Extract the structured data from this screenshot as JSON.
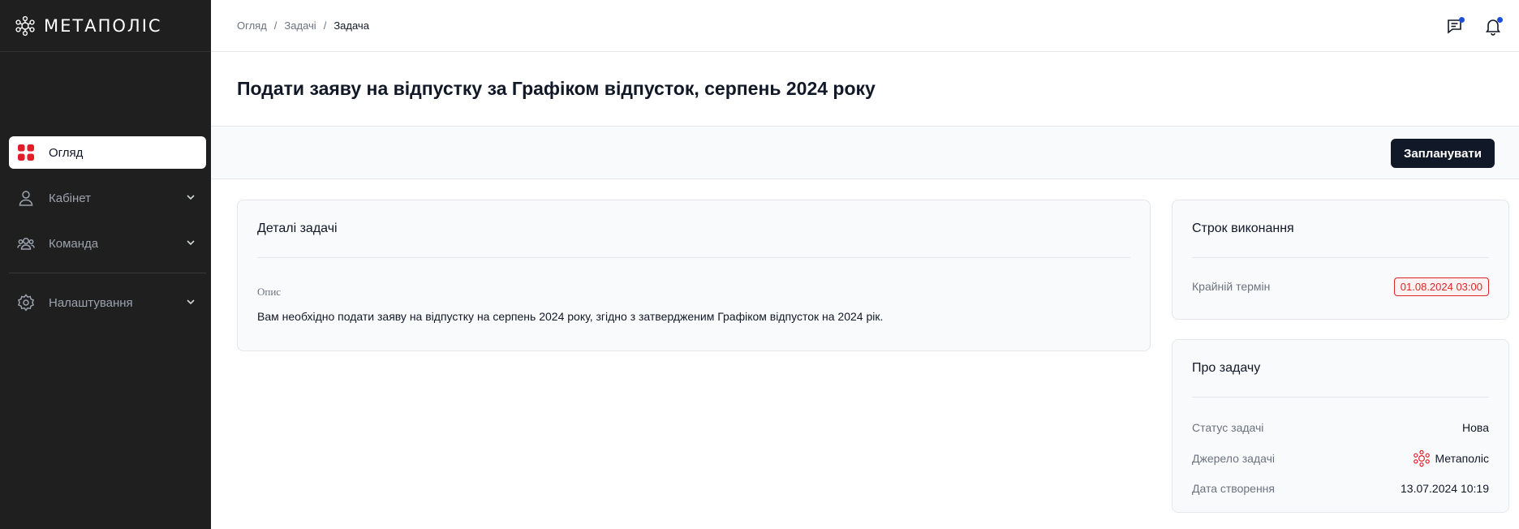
{
  "brand": {
    "name": "МЕТАПОЛІС"
  },
  "sidebar": {
    "items": [
      {
        "label": "Огляд",
        "icon": "grid-icon",
        "active": true
      },
      {
        "label": "Кабінет",
        "icon": "user-icon"
      },
      {
        "label": "Команда",
        "icon": "team-icon"
      },
      {
        "label": "Налаштування",
        "icon": "gear-icon"
      }
    ]
  },
  "breadcrumb": {
    "items": [
      "Огляд",
      "Задачі",
      "Задача"
    ],
    "separator": "/"
  },
  "page": {
    "title": "Подати заяву на відпустку за Графіком відпусток, серпень 2024 року"
  },
  "actions": {
    "plan_label": "Запланувати"
  },
  "details": {
    "title": "Деталі задачі",
    "desc_label": "Опис",
    "desc_text": "Вам необхідно подати заяву на відпустку на серпень 2024 року, згідно з затвердженим Графіком відпусток на 2024 рік."
  },
  "deadline": {
    "title": "Строк виконання",
    "label": "Крайній термін",
    "value": "01.08.2024 03:00"
  },
  "about": {
    "title": "Про задачу",
    "status_label": "Статус задачі",
    "status_value": "Нова",
    "source_label": "Джерело задачі",
    "source_value": "Метаполіс",
    "created_label": "Дата створення",
    "created_value": "13.07.2024 10:19"
  },
  "colors": {
    "accent": "#e11d2a",
    "sidebar_bg": "#1f1f1f",
    "button_bg": "#111827",
    "notification_dot": "#1d4ed8"
  }
}
